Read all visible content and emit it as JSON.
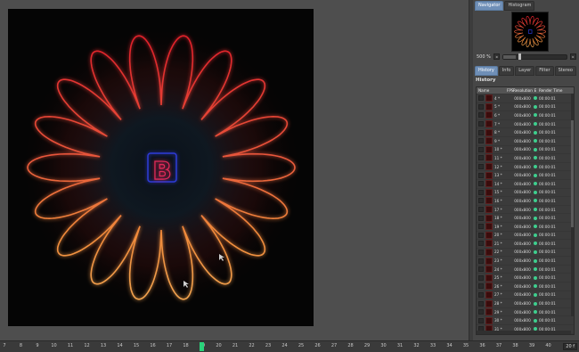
{
  "navigator": {
    "tabs": [
      {
        "label": "Navigator",
        "active": true
      },
      {
        "label": "Histogram",
        "active": false
      }
    ],
    "zoom_value": "500 %",
    "zoom_level_fraction": 0.2
  },
  "panel_tabs": [
    {
      "label": "History",
      "active": true
    },
    {
      "label": "Info",
      "active": false
    },
    {
      "label": "Layer",
      "active": false
    },
    {
      "label": "Filter",
      "active": false
    },
    {
      "label": "Stereo",
      "active": false
    }
  ],
  "history": {
    "title": "History",
    "columns": [
      "Name",
      "FPS",
      "Resolution",
      "E",
      "Render Time"
    ],
    "rows": [
      {
        "name": "4 *",
        "res": "000x800",
        "time": "00:00:01"
      },
      {
        "name": "5 *",
        "res": "000x800",
        "time": "00:00:01"
      },
      {
        "name": "6 *",
        "res": "000x800",
        "time": "00:00:01"
      },
      {
        "name": "7 *",
        "res": "000x800",
        "time": "00:00:01"
      },
      {
        "name": "8 *",
        "res": "000x800",
        "time": "00:00:01"
      },
      {
        "name": "9 *",
        "res": "000x800",
        "time": "00:00:01"
      },
      {
        "name": "10 *",
        "res": "000x800",
        "time": "00:00:01"
      },
      {
        "name": "11 *",
        "res": "000x800",
        "time": "00:00:01"
      },
      {
        "name": "12 *",
        "res": "000x800",
        "time": "00:00:01"
      },
      {
        "name": "13 *",
        "res": "000x800",
        "time": "00:00:01"
      },
      {
        "name": "14 *",
        "res": "000x800",
        "time": "00:00:01"
      },
      {
        "name": "15 *",
        "res": "000x800",
        "time": "00:00:01"
      },
      {
        "name": "16 *",
        "res": "000x800",
        "time": "00:00:01"
      },
      {
        "name": "17 *",
        "res": "000x800",
        "time": "00:00:01"
      },
      {
        "name": "18 *",
        "res": "000x800",
        "time": "00:00:01"
      },
      {
        "name": "19 *",
        "res": "000x800",
        "time": "00:00:01"
      },
      {
        "name": "20 *",
        "res": "000x800",
        "time": "00:00:01"
      },
      {
        "name": "21 *",
        "res": "000x800",
        "time": "00:00:01"
      },
      {
        "name": "22 *",
        "res": "000x800",
        "time": "00:00:01"
      },
      {
        "name": "23 *",
        "res": "000x800",
        "time": "00:00:01"
      },
      {
        "name": "24 *",
        "res": "000x800",
        "time": "00:00:01"
      },
      {
        "name": "25 *",
        "res": "000x800",
        "time": "00:00:01"
      },
      {
        "name": "26 *",
        "res": "000x800",
        "time": "00:00:01"
      },
      {
        "name": "27 *",
        "res": "000x800",
        "time": "00:00:01"
      },
      {
        "name": "28 *",
        "res": "000x800",
        "time": "00:00:01"
      },
      {
        "name": "29 *",
        "res": "000x800",
        "time": "00:00:01"
      },
      {
        "name": "30 *",
        "res": "000x800",
        "time": "00:00:01"
      },
      {
        "name": "31 *",
        "res": "000x800",
        "time": "00:00:01"
      },
      {
        "name": "32 *",
        "res": "000x800",
        "time": "00:00:01"
      },
      {
        "name": "33 *",
        "res": "000x800",
        "time": "00:00:01"
      }
    ]
  },
  "timeline": {
    "frames": [
      "7",
      "8",
      "9",
      "10",
      "11",
      "12",
      "13",
      "14",
      "15",
      "16",
      "17",
      "18",
      "19",
      "20",
      "21",
      "22",
      "23",
      "24",
      "25",
      "26",
      "27",
      "28",
      "29",
      "30",
      "31",
      "32",
      "33",
      "34",
      "35",
      "36",
      "37",
      "38",
      "39",
      "40"
    ],
    "current_frame": "19",
    "fps": "20 f"
  },
  "colors": {
    "accent_tab": "#6f8fb7",
    "status_dot": "#3ecf8e",
    "playhead": "#29d37a"
  },
  "render": {
    "logo_letter": "B"
  }
}
